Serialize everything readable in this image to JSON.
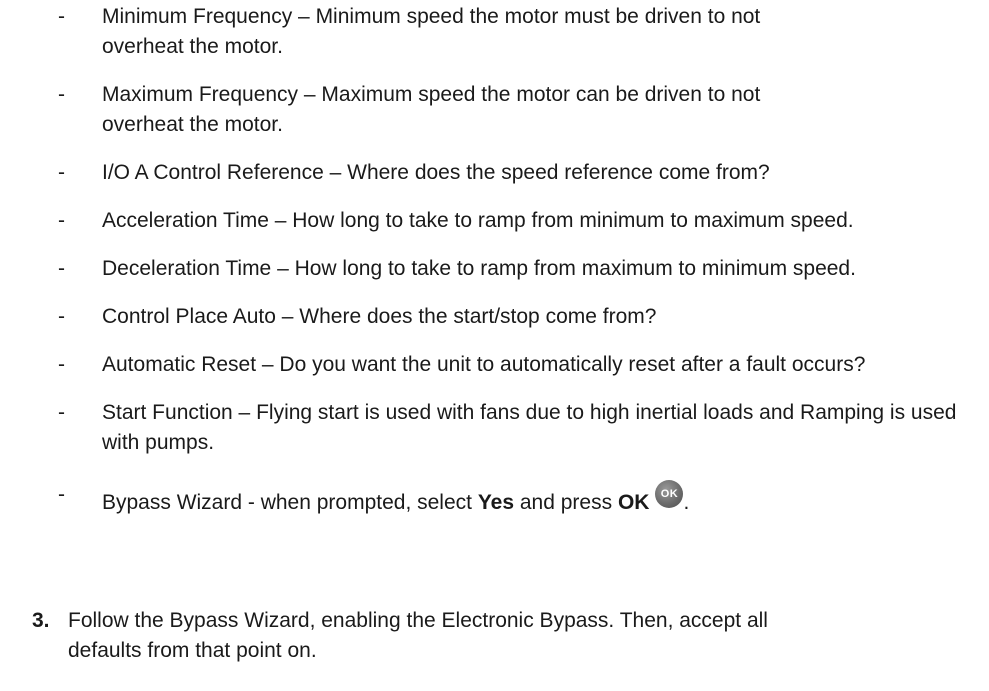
{
  "bullets": [
    {
      "dash": "-",
      "text": "Minimum Frequency – Minimum speed the motor must be driven to not overheat the motor."
    },
    {
      "dash": "-",
      "text": "Maximum Frequency – Maximum speed the motor can be driven to not overheat the motor."
    },
    {
      "dash": "-",
      "text": "I/O A Control Reference – Where does the speed reference come from?"
    },
    {
      "dash": "-",
      "text": "Acceleration Time – How long to take to ramp from minimum to maximum speed."
    },
    {
      "dash": "-",
      "text": "Deceleration Time – How long to take to ramp from maximum to minimum speed."
    },
    {
      "dash": "-",
      "text": "Control Place Auto – Where does the start/stop come from?"
    },
    {
      "dash": "-",
      "text": "Automatic Reset – Do you want the unit to automatically reset after a fault occurs?"
    },
    {
      "dash": "-",
      "text": "Start Function – Flying start is used with fans due to high inertial loads and Ramping is used with pumps."
    }
  ],
  "wizard_bullet": {
    "dash": "-",
    "prefix": "Bypass Wizard - when prompted, select ",
    "yes": "Yes",
    "middle": " and press ",
    "ok": "OK",
    "suffix": ".",
    "ok_icon_label": "OK",
    "ok_icon": "ok-button-icon"
  },
  "step3": {
    "number": "3.",
    "text": "Follow the Bypass Wizard, enabling the Electronic Bypass. Then, accept all defaults from that point on."
  }
}
